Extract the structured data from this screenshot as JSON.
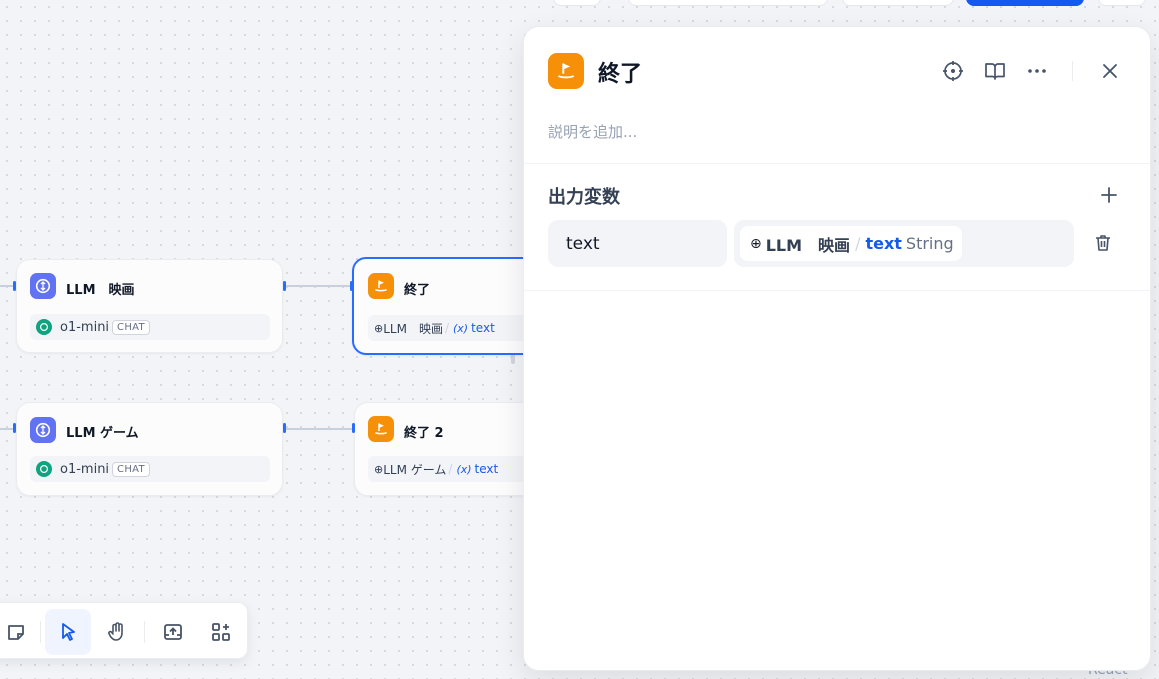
{
  "canvas": {
    "nodes": [
      {
        "title": "LLM　映画",
        "model": "o1-mini",
        "mode": "CHAT"
      },
      {
        "title": "終了",
        "var_source": "LLM　映画",
        "var_name": "text"
      },
      {
        "title": "LLM ゲーム",
        "model": "o1-mini",
        "mode": "CHAT"
      },
      {
        "title": "終了 2",
        "var_source": "LLM ゲーム",
        "var_name": "text"
      }
    ],
    "var_x": "(x)",
    "separator": "/",
    "watermark": "React Flow"
  },
  "panel": {
    "title": "終了",
    "description_placeholder": "説明を追加...",
    "section_title": "出力変数",
    "output": {
      "name": "text",
      "ref_node": "LLM　映画",
      "ref_var": "text",
      "ref_type": "String"
    }
  },
  "colors": {
    "accent": "#155aef",
    "llm_icon": "#6172f3",
    "end_icon": "#f79009",
    "openai": "#10a37f"
  }
}
